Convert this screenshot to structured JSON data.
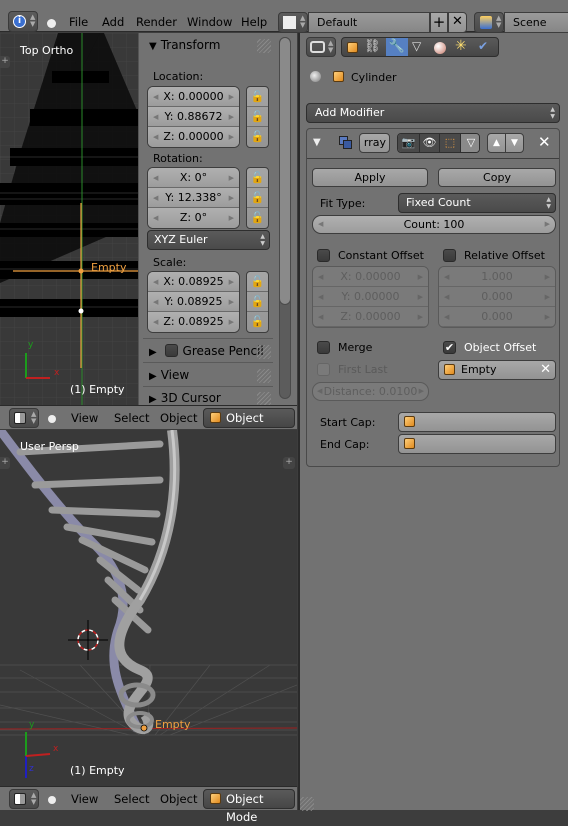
{
  "top_header": {
    "menus": [
      "File",
      "Add",
      "Render",
      "Window",
      "Help"
    ],
    "layout": "Default",
    "scene": "Scene"
  },
  "top_viewport": {
    "view_label": "Top Ortho",
    "object_label": "Empty",
    "status": "(1) Empty",
    "axis_x": "x",
    "axis_y": "y"
  },
  "npanel": {
    "transform_title": "Transform",
    "location_label": "Location:",
    "location": [
      "X: 0.00000",
      "Y: 0.88672",
      "Z: 0.00000"
    ],
    "rotation_label": "Rotation:",
    "rotation": [
      "X: 0°",
      "Y: 12.338°",
      "Z: 0°"
    ],
    "rotation_mode": "XYZ Euler",
    "scale_label": "Scale:",
    "scale": [
      "X: 0.08925",
      "Y: 0.08925",
      "Z: 0.08925"
    ],
    "panels": [
      "Grease Pencil",
      "View",
      "3D Cursor"
    ]
  },
  "viewport_header": {
    "menus": [
      "View",
      "Select",
      "Object"
    ],
    "mode": "Object Mode"
  },
  "bottom_viewport": {
    "view_label": "User Persp",
    "object_label": "Empty",
    "status": "(1) Empty",
    "axis_x": "x",
    "axis_y": "y",
    "axis_z": "z"
  },
  "properties": {
    "object_name": "Cylinder",
    "add_modifier": "Add Modifier",
    "modifier_name": "rray",
    "apply": "Apply",
    "copy": "Copy",
    "fit_type_label": "Fit Type:",
    "fit_type": "Fixed Count",
    "count": "Count: 100",
    "constant_offset": {
      "label": "Constant Offset",
      "checked": false,
      "values": [
        "X: 0.00000",
        "Y: 0.00000",
        "Z: 0.00000"
      ]
    },
    "relative_offset": {
      "label": "Relative Offset",
      "checked": false,
      "values": [
        "1.000",
        "0.000",
        "0.000"
      ]
    },
    "merge": {
      "label": "Merge",
      "checked": false
    },
    "object_offset": {
      "label": "Object Offset",
      "checked": true,
      "object": "Empty"
    },
    "first_last": {
      "label": "First Last",
      "checked": false
    },
    "distance": "Distance: 0.0100",
    "start_cap_label": "Start Cap:",
    "end_cap_label": "End Cap:"
  },
  "colors": {
    "accent_active_tab": "#5680c2",
    "selected_object": "#f0a040",
    "axis_x": "#c02020",
    "axis_y": "#20a020",
    "axis_z": "#2020c0"
  }
}
